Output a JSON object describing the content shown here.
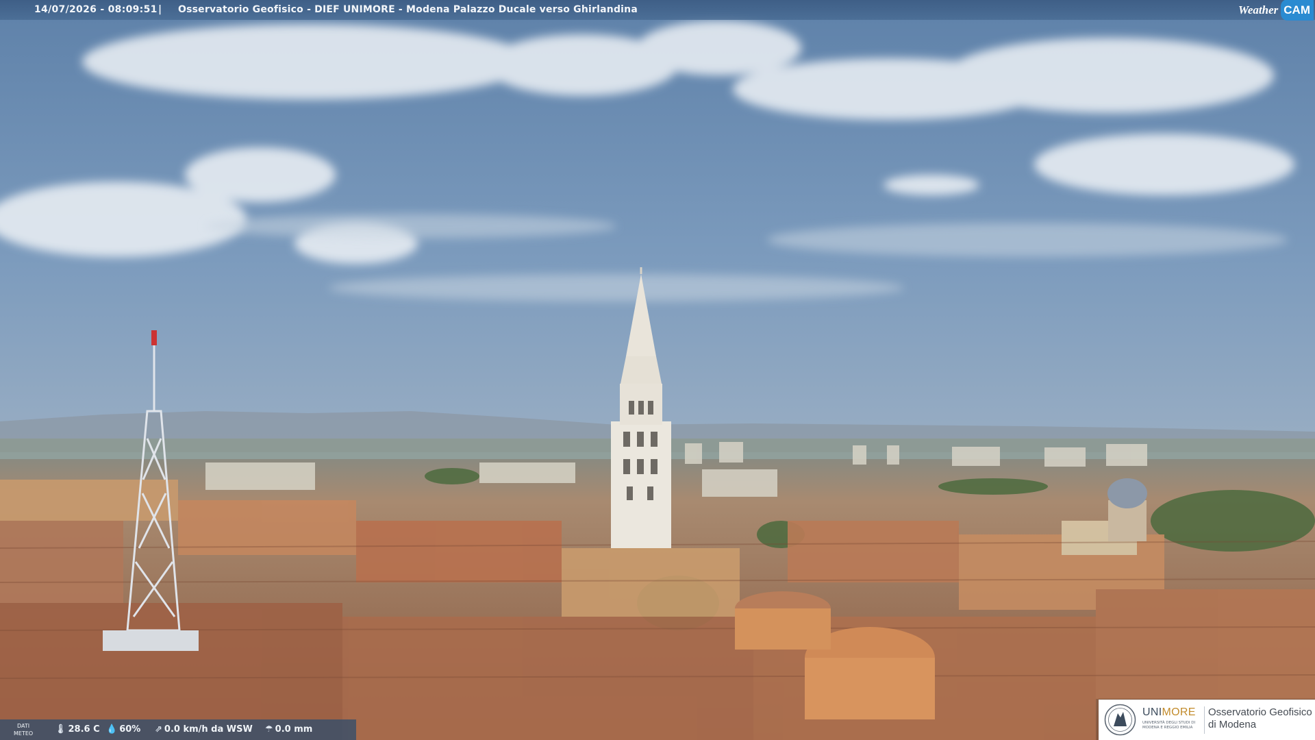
{
  "header": {
    "timestamp": "14/07/2026 - 08:09:51",
    "separator": "|",
    "camera_title": "Osservatorio Geofisico - DIEF UNIMORE - Modena Palazzo Ducale verso Ghirlandina"
  },
  "brand": {
    "weather": "Weather",
    "cam": "CAM"
  },
  "weather_data": {
    "label_line1": "DATI",
    "label_line2": "METEO",
    "temperature": "28.6 C",
    "humidity": "60%",
    "wind": "0.0 km/h da WSW",
    "rain": "0.0 mm",
    "icons": [
      "thermometer-icon",
      "humidity-drop-icon",
      "wind-icon",
      "rain-icon"
    ]
  },
  "logo": {
    "uni_part1": "UNI",
    "uni_part2": "MORE",
    "university_line1": "UNIVERSITÀ DEGLI STUDI DI",
    "university_line2": "MODENA E REGGIO EMILIA",
    "observatory_line1": "Osservatorio Geofisico",
    "observatory_line2": "di Modena"
  },
  "colors": {
    "sky_top": "#6f8fb3",
    "sky_horizon": "#a9b8c8",
    "roof_terracotta": "#b57a55",
    "facade_ochre": "#d9b27a",
    "tower_marble": "#e8e4dc",
    "bar_blue": "#3a5a82",
    "brand_cam_blue": "#2a8bd1",
    "unimore_gold": "#c28b2b"
  }
}
